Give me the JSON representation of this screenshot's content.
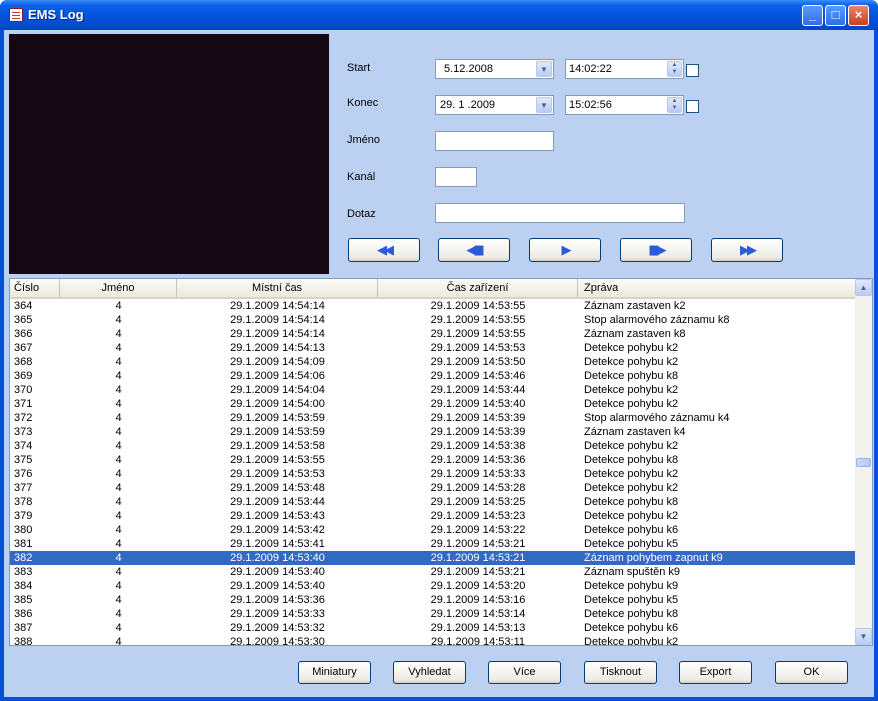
{
  "window": {
    "title": "EMS Log"
  },
  "filters": {
    "start_label": "Start",
    "start_date": "5.12.2008",
    "start_time": "14:02:22",
    "end_label": "Konec",
    "end_date": "29. 1 .2009",
    "end_time": "15:02:56",
    "name_label": "Jméno",
    "name_value": "",
    "channel_label": "Kanál",
    "channel_value": "",
    "query_label": "Dotaz",
    "query_value": ""
  },
  "navigation": [
    {
      "name": "first-button",
      "icon": "double-left-arrow-icon",
      "glyph": "◀◀"
    },
    {
      "name": "prev-button",
      "icon": "step-back-icon",
      "glyph": "◀▮▮"
    },
    {
      "name": "play-button",
      "icon": "play-icon",
      "glyph": "▶"
    },
    {
      "name": "next-button",
      "icon": "step-forward-icon",
      "glyph": "▮▮▶"
    },
    {
      "name": "last-button",
      "icon": "double-right-arrow-icon",
      "glyph": "▶▶"
    }
  ],
  "table": {
    "columns": [
      "Číslo",
      "Jméno",
      "Místní čas",
      "Čas zařízení",
      "Zpráva"
    ],
    "selected_index": 18,
    "rows": [
      [
        "364",
        "4",
        "29.1.2009 14:54:14",
        "29.1.2009 14:53:55",
        "Záznam zastaven k2"
      ],
      [
        "365",
        "4",
        "29.1.2009 14:54:14",
        "29.1.2009 14:53:55",
        "Stop alarmového záznamu k8"
      ],
      [
        "366",
        "4",
        "29.1.2009 14:54:14",
        "29.1.2009 14:53:55",
        "Záznam zastaven k8"
      ],
      [
        "367",
        "4",
        "29.1.2009 14:54:13",
        "29.1.2009 14:53:53",
        "Detekce pohybu k2"
      ],
      [
        "368",
        "4",
        "29.1.2009 14:54:09",
        "29.1.2009 14:53:50",
        "Detekce pohybu k2"
      ],
      [
        "369",
        "4",
        "29.1.2009 14:54:06",
        "29.1.2009 14:53:46",
        "Detekce pohybu k8"
      ],
      [
        "370",
        "4",
        "29.1.2009 14:54:04",
        "29.1.2009 14:53:44",
        "Detekce pohybu k2"
      ],
      [
        "371",
        "4",
        "29.1.2009 14:54:00",
        "29.1.2009 14:53:40",
        "Detekce pohybu k2"
      ],
      [
        "372",
        "4",
        "29.1.2009 14:53:59",
        "29.1.2009 14:53:39",
        "Stop alarmového záznamu k4"
      ],
      [
        "373",
        "4",
        "29.1.2009 14:53:59",
        "29.1.2009 14:53:39",
        "Záznam zastaven k4"
      ],
      [
        "374",
        "4",
        "29.1.2009 14:53:58",
        "29.1.2009 14:53:38",
        "Detekce pohybu k2"
      ],
      [
        "375",
        "4",
        "29.1.2009 14:53:55",
        "29.1.2009 14:53:36",
        "Detekce pohybu k8"
      ],
      [
        "376",
        "4",
        "29.1.2009 14:53:53",
        "29.1.2009 14:53:33",
        "Detekce pohybu k2"
      ],
      [
        "377",
        "4",
        "29.1.2009 14:53:48",
        "29.1.2009 14:53:28",
        "Detekce pohybu k2"
      ],
      [
        "378",
        "4",
        "29.1.2009 14:53:44",
        "29.1.2009 14:53:25",
        "Detekce pohybu k8"
      ],
      [
        "379",
        "4",
        "29.1.2009 14:53:43",
        "29.1.2009 14:53:23",
        "Detekce pohybu k2"
      ],
      [
        "380",
        "4",
        "29.1.2009 14:53:42",
        "29.1.2009 14:53:22",
        "Detekce pohybu k6"
      ],
      [
        "381",
        "4",
        "29.1.2009 14:53:41",
        "29.1.2009 14:53:21",
        "Detekce pohybu k5"
      ],
      [
        "382",
        "4",
        "29.1.2009 14:53:40",
        "29.1.2009 14:53:21",
        "Záznam pohybem zapnut k9"
      ],
      [
        "383",
        "4",
        "29.1.2009 14:53:40",
        "29.1.2009 14:53:21",
        "Záznam spuštěn k9"
      ],
      [
        "384",
        "4",
        "29.1.2009 14:53:40",
        "29.1.2009 14:53:20",
        "Detekce pohybu k9"
      ],
      [
        "385",
        "4",
        "29.1.2009 14:53:36",
        "29.1.2009 14:53:16",
        "Detekce pohybu k5"
      ],
      [
        "386",
        "4",
        "29.1.2009 14:53:33",
        "29.1.2009 14:53:14",
        "Detekce pohybu k8"
      ],
      [
        "387",
        "4",
        "29.1.2009 14:53:32",
        "29.1.2009 14:53:13",
        "Detekce pohybu k6"
      ],
      [
        "388",
        "4",
        "29.1.2009 14:53:30",
        "29.1.2009 14:53:11",
        "Detekce pohybu k2"
      ]
    ]
  },
  "buttons": {
    "thumbnails": "Miniatury",
    "search": "Vyhledat",
    "more": "Více",
    "print": "Tisknout",
    "export": "Export",
    "ok": "OK"
  }
}
